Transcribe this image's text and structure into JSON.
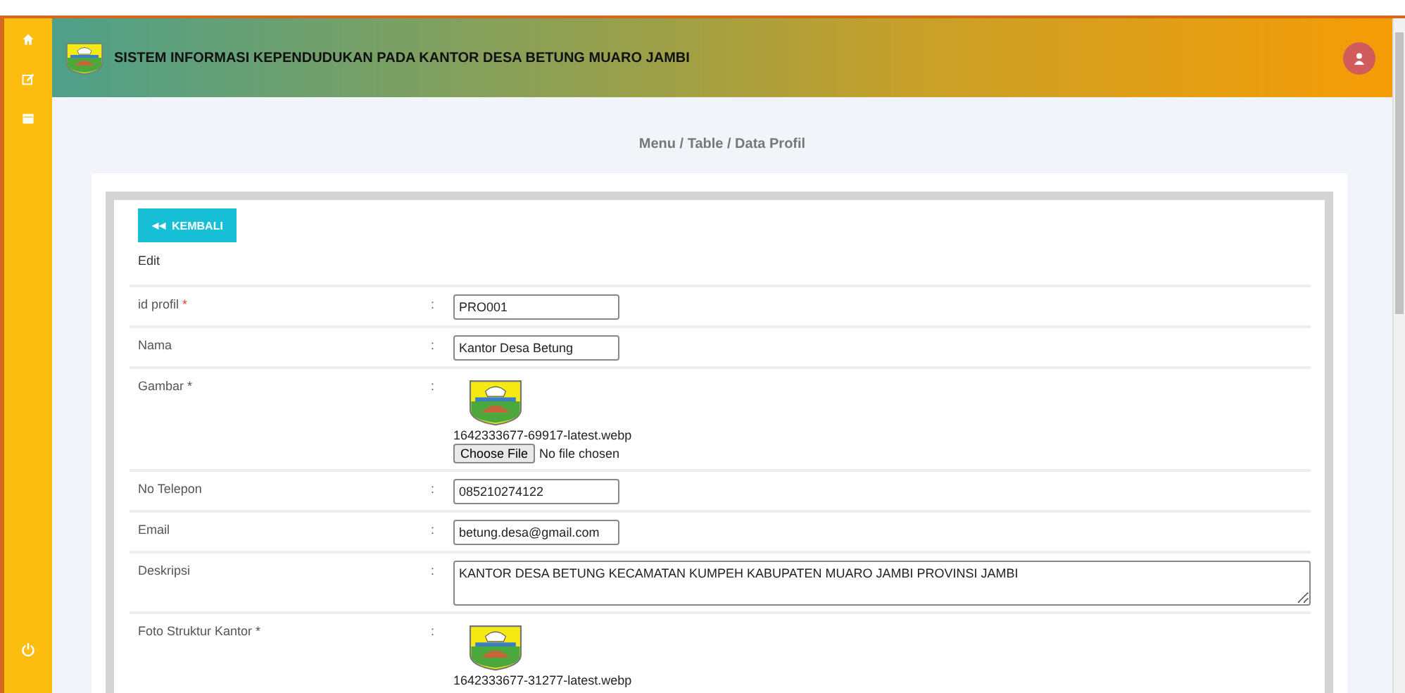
{
  "header": {
    "title": "SISTEM INFORMASI KEPENDUDUKAN PADA KANTOR DESA BETUNG MUARO JAMBI"
  },
  "sidebar": {
    "items": [
      {
        "kind": "home"
      },
      {
        "kind": "edit"
      },
      {
        "kind": "calendar"
      }
    ],
    "footer": {
      "kind": "power"
    }
  },
  "breadcrumb": "Menu / Table / Data Profil",
  "back_button": {
    "icon": "◀◀",
    "label": "KEMBALI"
  },
  "form_title": "Edit",
  "fields": [
    {
      "kind": "text",
      "label": "id profil",
      "mark": "*",
      "mark_alert": true,
      "separator": ":",
      "value": "PRO001"
    },
    {
      "kind": "text",
      "label": "Nama",
      "separator": ":",
      "value": "Kantor Desa Betung"
    },
    {
      "kind": "image",
      "label": "Gambar",
      "mark": "*",
      "mark_alert": false,
      "separator": ":",
      "filename": "1642333677-69917-latest.webp",
      "file_button": "Choose File",
      "file_status": "No file chosen"
    },
    {
      "kind": "text",
      "label": "No Telepon",
      "separator": ":",
      "value": "085210274122"
    },
    {
      "kind": "text",
      "label": "Email",
      "separator": ":",
      "value": "betung.desa@gmail.com"
    },
    {
      "kind": "textarea",
      "label": "Deskripsi",
      "separator": ":",
      "value": "KANTOR DESA BETUNG KECAMATAN KUMPEH KABUPATEN MUARO JAMBI PROVINSI JAMBI"
    },
    {
      "kind": "image",
      "label": "Foto Struktur Kantor",
      "mark": "*",
      "mark_alert": false,
      "separator": ":",
      "filename": "1642333677-31277-latest.webp"
    }
  ]
}
